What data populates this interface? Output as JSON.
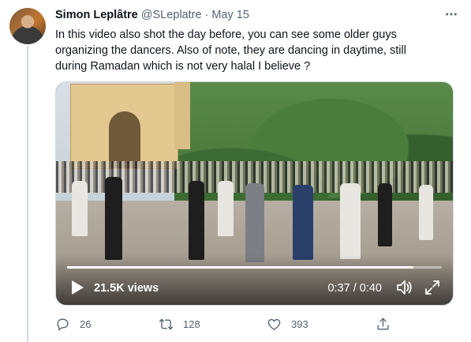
{
  "tweet": {
    "display_name": "Simon Leplâtre",
    "handle": "@SLeplatre",
    "separator": "·",
    "date": "May 15",
    "text": "In this video also shot the day before, you can see some older guys\norganizing the dancers. Also of note, they are dancing in daytime, still\nduring Ramadan which is not very halal I believe ?"
  },
  "video": {
    "views": "21.5K views",
    "time": "0:37 / 0:40",
    "progress": 0.925
  },
  "actions": {
    "reply_count": "26",
    "retweet_count": "128",
    "like_count": "393"
  },
  "icons": {
    "more": "more-icon",
    "play": "play-icon",
    "volume": "volume-icon",
    "fullscreen": "fullscreen-icon",
    "reply": "reply-icon",
    "retweet": "retweet-icon",
    "like": "like-icon",
    "share": "share-icon"
  },
  "colors": {
    "text_primary": "#0f1419",
    "text_secondary": "#536471",
    "divider": "#cfd9de"
  }
}
